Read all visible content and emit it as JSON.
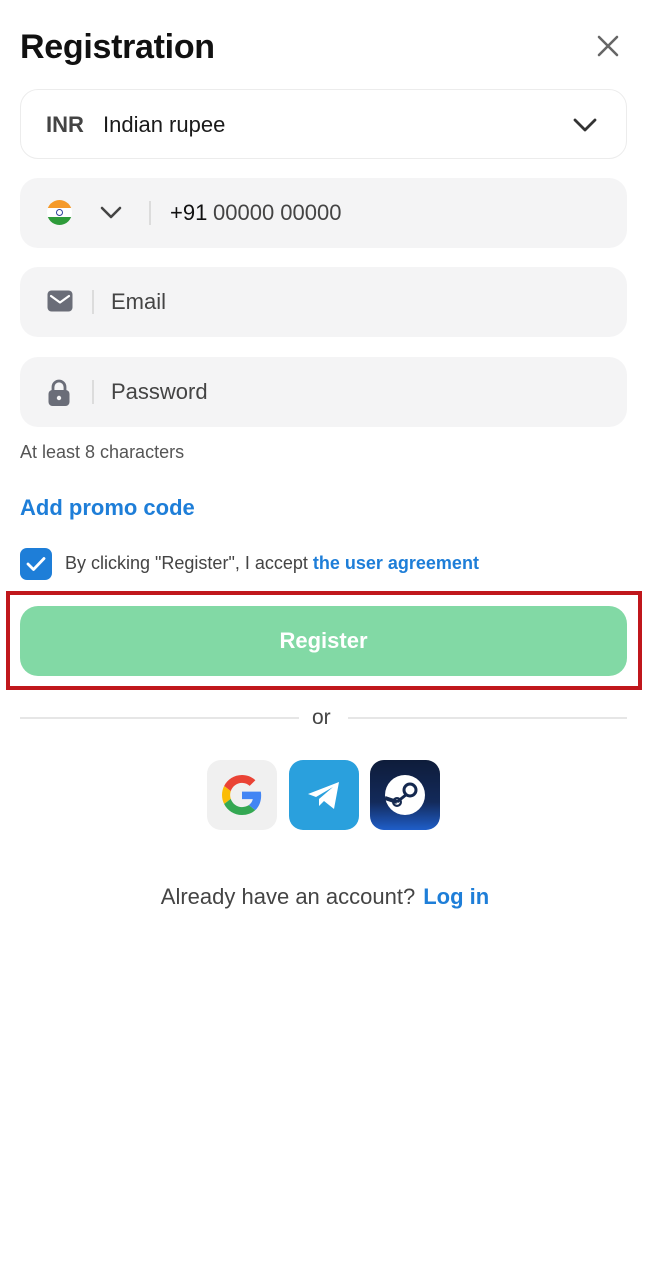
{
  "header": {
    "title": "Registration"
  },
  "currency": {
    "code": "INR",
    "name": "Indian rupee"
  },
  "phone": {
    "prefix": "+91",
    "placeholder": "00000 00000"
  },
  "email": {
    "placeholder": "Email"
  },
  "password": {
    "placeholder": "Password",
    "hint": "At least 8 characters"
  },
  "promo": {
    "label": "Add promo code"
  },
  "agreement": {
    "checked": true,
    "text": "By clicking \"Register\", I accept ",
    "link": "the user agreement"
  },
  "register": {
    "label": "Register"
  },
  "divider": {
    "label": "or"
  },
  "social": {
    "providers": [
      "google-icon",
      "telegram-icon",
      "steam-icon"
    ]
  },
  "footer": {
    "text": "Already have an account?",
    "login_label": "Log in"
  },
  "colors": {
    "accent": "#1e7ed8",
    "register_bg": "#82d9a5",
    "highlight": "#c0171c",
    "field_bg": "#f4f4f5"
  }
}
